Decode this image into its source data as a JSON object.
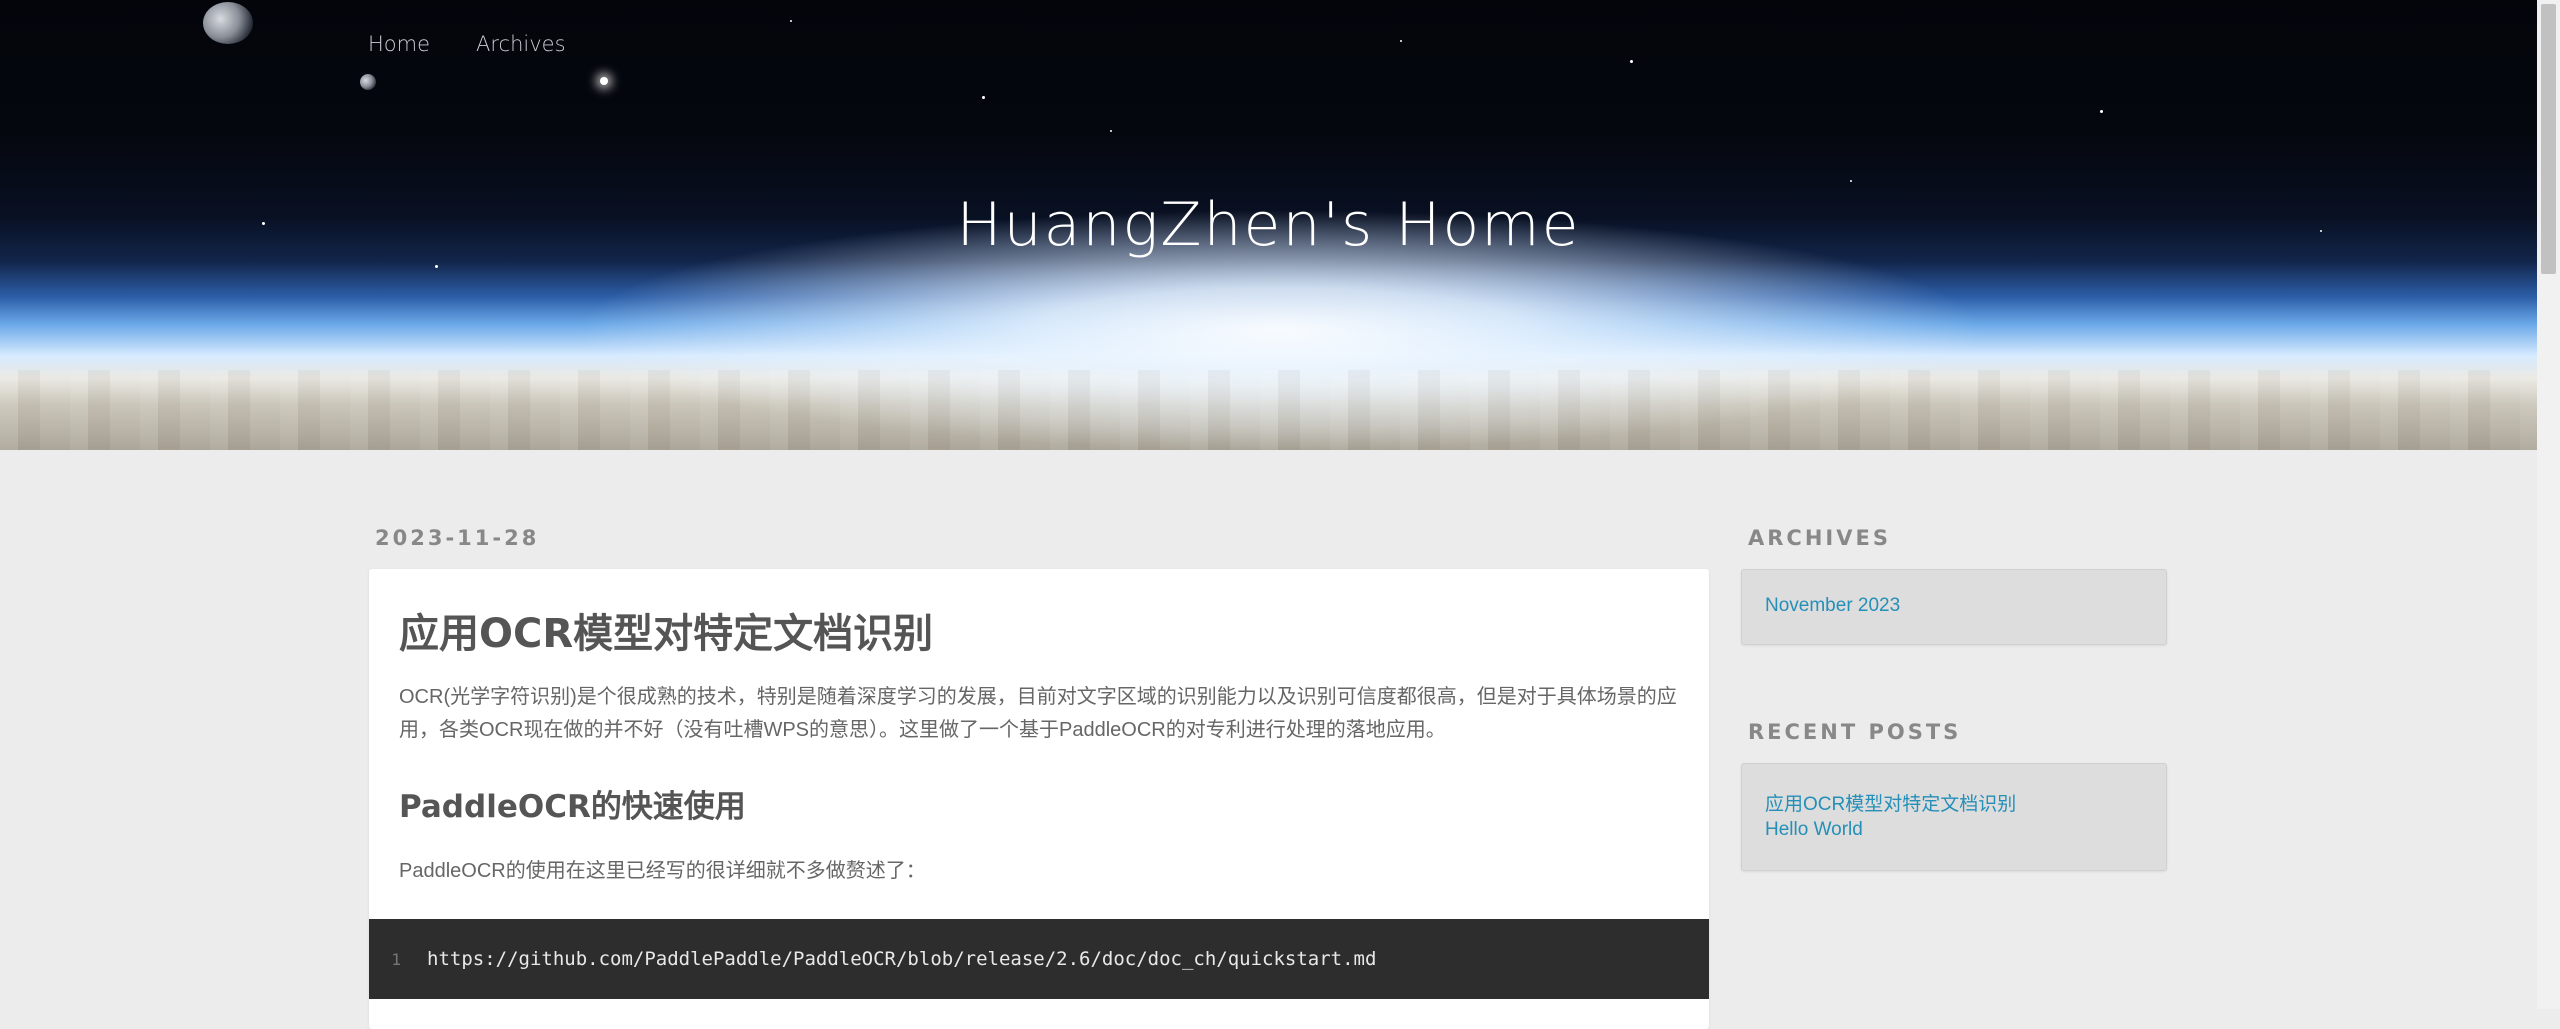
{
  "nav": {
    "home": "Home",
    "archives": "Archives"
  },
  "site_title": "HuangZhen's Home",
  "post": {
    "date": "2023-11-28",
    "title": "应用OCR模型对特定文档识别",
    "intro": "OCR(光学字符识别)是个很成熟的技术，特别是随着深度学习的发展，目前对文字区域的识别能力以及识别可信度都很高，但是对于具体场景的应用，各类OCR现在做的并不好（没有吐槽WPS的意思）。这里做了一个基于PaddleOCR的对专利进行处理的落地应用。",
    "section_heading": "PaddleOCR的快速使用",
    "section_text": "PaddleOCR的使用在这里已经写的很详细就不多做赘述了：",
    "code_line_number": "1",
    "code": "https://github.com/PaddlePaddle/PaddleOCR/blob/release/2.6/doc/doc_ch/quickstart.md"
  },
  "sidebar": {
    "archives_title": "ARCHIVES",
    "archives": [
      "November 2023"
    ],
    "recent_title": "RECENT POSTS",
    "recent_posts": [
      "应用OCR模型对特定文档识别",
      "Hello World"
    ]
  },
  "colors": {
    "link": "#258fb8",
    "page_bg": "#ececec",
    "code_bg": "#2d2d2d"
  }
}
